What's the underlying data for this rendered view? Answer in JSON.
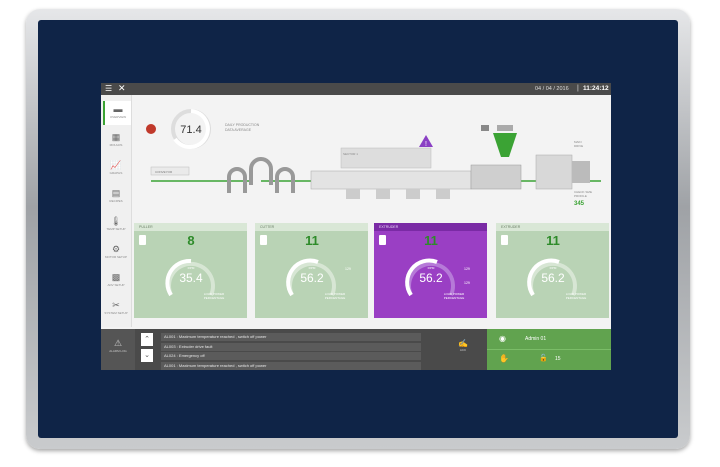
{
  "topbar": {
    "menu_icon": "hamburger-icon",
    "close_icon": "close-icon",
    "date": "04 / 04 / 2016",
    "time": "11:24:12"
  },
  "sidebar": {
    "items": [
      {
        "label": "OVERVIEW",
        "icon": "overview-icon"
      },
      {
        "label": "MOULDS",
        "icon": "moulds-icon"
      },
      {
        "label": "GRAPHS",
        "icon": "graphs-icon"
      },
      {
        "label": "RECIPES",
        "icon": "recipes-icon"
      },
      {
        "label": "TEMP SETUP",
        "icon": "temp-setup-icon"
      },
      {
        "label": "MOTOR SETUP",
        "icon": "motor-setup-icon"
      },
      {
        "label": "ADV SETUP",
        "icon": "adv-setup-icon"
      },
      {
        "label": "SYSTEM SETUP",
        "icon": "system-setup-icon"
      }
    ]
  },
  "process": {
    "gauge_value": "71.4",
    "gauge_label": "DAILY PRODUCTION\nDATA AVERAGE",
    "conveyor_label": "CONVEYOR",
    "section_label": "SECTOR 1",
    "main_drive_label": "MAIN\nDRIVE",
    "check_label": "CHECK SIZE\nPROFILE",
    "check_value": "345"
  },
  "cards": [
    {
      "name": "PULLER",
      "big": "8",
      "value": "35.4",
      "unit": "RPM",
      "foot": "LOAD POWER\nPERCENTAGE",
      "selected": false
    },
    {
      "name": "CUTTER",
      "big": "11",
      "value": "56.2",
      "unit": "RPM",
      "foot": "LOAD POWER\nPERCENTAGE",
      "selected": false
    },
    {
      "name": "EXTRUDER",
      "big": "11",
      "value": "56.2",
      "unit": "RPM",
      "foot": "LOAD POWER\nPERCENTAGE",
      "selected": true
    },
    {
      "name": "EXTRUDER",
      "big": "11",
      "value": "56.2",
      "unit": "RPM",
      "foot": "LOAD POWER\nPERCENTAGE",
      "selected": false
    }
  ],
  "card_side_values": [
    "129",
    "129"
  ],
  "alarms": [
    "AL001 : Maximum temperature reached , switch off power",
    "AL003 : Extruder drive fault",
    "AL024 : Emergency off",
    "AL001 : Maximum temperature reached , switch off power"
  ],
  "alarm_label": "ALARM LOG",
  "ack_label": "ACK",
  "user": {
    "name": "Admin 01",
    "count": "15"
  },
  "colors": {
    "accent_green": "#3ba334",
    "card_green": "#b9d3b5",
    "selected_purple": "#9a3fc4",
    "bezel": "#0f2447"
  }
}
